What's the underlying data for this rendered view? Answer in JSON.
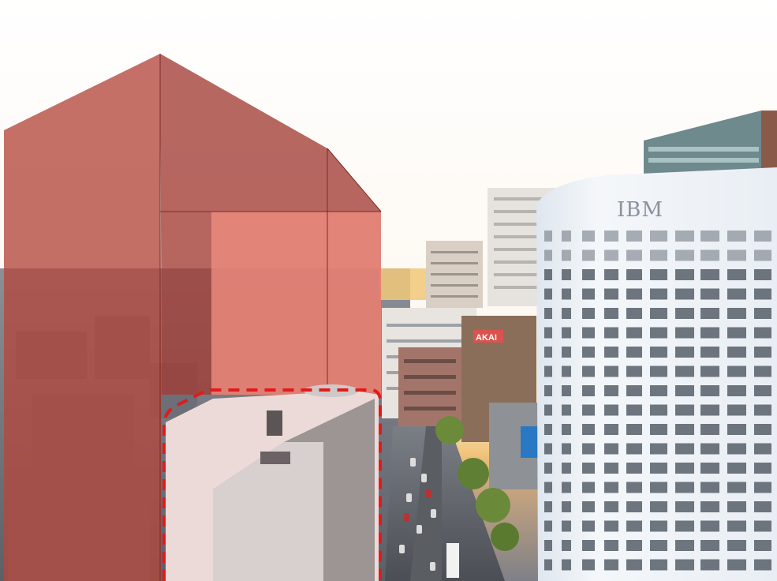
{
  "scene": {
    "sign_text": "IBM",
    "store_sign_text": "AKAI",
    "colors": {
      "massing_red": "#b3483e",
      "massing_light": "#ef8c80",
      "boundary_dash": "#e01b1b",
      "sky": "#fbf7f2",
      "sunset_glow": "#f2c879",
      "ibm_facade": "#eef2f6",
      "window_dark": "#4c5560"
    }
  }
}
